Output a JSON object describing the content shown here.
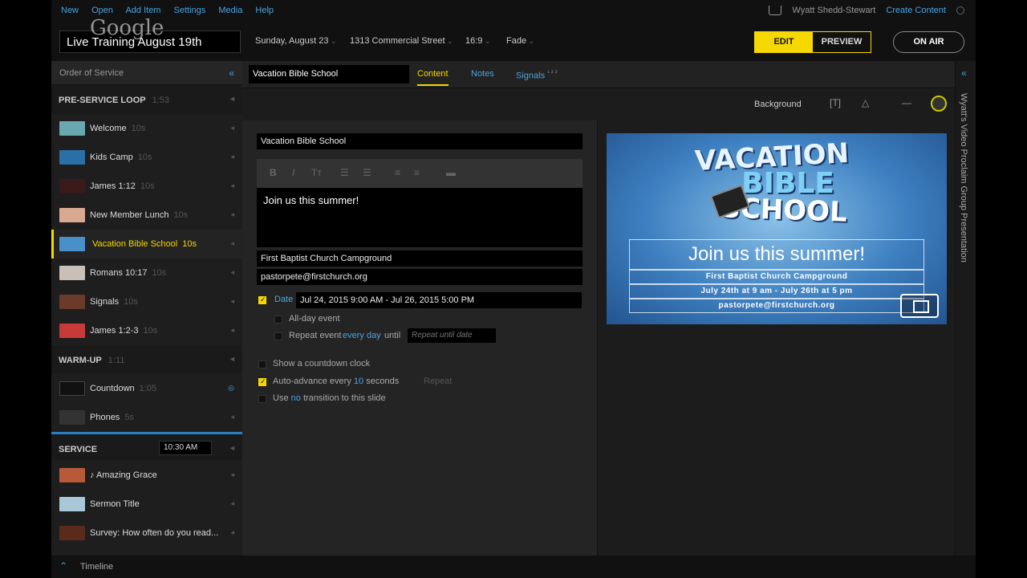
{
  "menu": [
    "New",
    "Open",
    "Add Item",
    "Settings",
    "Media",
    "Help"
  ],
  "user": "Wyatt  Shedd-Stewart",
  "create_content": "Create Content",
  "watermark": "Google",
  "presentation_title": "Live Training August 19th",
  "header": {
    "date": "Sunday, August 23",
    "location": "1313 Commercial Street",
    "ratio": "16:9",
    "transition": "Fade",
    "edit": "EDIT",
    "preview": "PREVIEW",
    "on_air": "ON AIR"
  },
  "sidebar": {
    "title": "Order of Service",
    "sections": [
      {
        "name": "PRE-SERVICE LOOP",
        "duration": "1:53",
        "items": [
          {
            "label": "Welcome",
            "dur": "10s",
            "color": "#6aa8b0"
          },
          {
            "label": "Kids Camp",
            "dur": "10s",
            "color": "#2a6fa8"
          },
          {
            "label": "James 1:12",
            "dur": "10s",
            "color": "#3a1a1a"
          },
          {
            "label": "New Member Lunch",
            "dur": "10s",
            "color": "#d8a890"
          },
          {
            "label": "Vacation Bible School",
            "dur": "10s",
            "color": "#4a90c8",
            "active": true
          },
          {
            "label": "Romans 10:17",
            "dur": "10s",
            "color": "#c8c0b8"
          },
          {
            "label": "Signals",
            "dur": "10s",
            "color": "#6a3a2a"
          },
          {
            "label": "James 1:2-3",
            "dur": "10s",
            "color": "#c83a3a"
          }
        ]
      },
      {
        "name": "WARM-UP",
        "duration": "1:11",
        "items": [
          {
            "label": "Countdown",
            "dur": "1:05",
            "color": "#111"
          },
          {
            "label": "Phones",
            "dur": "5s",
            "color": "#333"
          }
        ]
      },
      {
        "name": "SERVICE",
        "time": "10:30 AM",
        "items": [
          {
            "label": "♪  Amazing Grace",
            "dur": "",
            "color": "#b85a3a"
          },
          {
            "label": "Sermon Title",
            "dur": "",
            "color": "#a8c8d8"
          },
          {
            "label": "Survey: How often do you read...",
            "dur": "",
            "color": "#5a2a1a"
          }
        ]
      }
    ]
  },
  "tabs": {
    "slide_title": "Vacation Bible School",
    "content": "Content",
    "notes": "Notes",
    "signals": "Signals",
    "signals_badges": "¹ ² ³"
  },
  "toolbar": {
    "background": "Background"
  },
  "editor": {
    "title_field": "Vacation Bible School",
    "body": "Join us this summer!",
    "location": "First Baptist Church Campground",
    "email": "pastorpete@firstchurch.org",
    "date_label": "Date",
    "date_value": "Jul 24, 2015 9:00 AM - Jul 26, 2015 5:00 PM",
    "all_day": "All-day event",
    "repeat": "Repeat event",
    "every_day": "every day",
    "until": "until",
    "repeat_until": "Repeat until date",
    "countdown": "Show a countdown clock",
    "auto_advance_pre": "Auto-advance every",
    "auto_advance_num": "10",
    "auto_advance_post": "seconds",
    "repeat_link": "Repeat",
    "use": "Use",
    "no": "no",
    "transition_text": "transition to this slide"
  },
  "preview": {
    "logo_l1": "VACATION",
    "logo_l2": "BIBLE",
    "logo_l3": "SCHOOL",
    "headline": "Join us this summer!",
    "line1": "First Baptist Church Campground",
    "line2": "July 24th at 9 am - July 26th at 5 pm",
    "line3": "pastorpete@firstchurch.org"
  },
  "right_panel": "Wyatt's Video Proclaim Group Presentation",
  "footer": "Timeline"
}
